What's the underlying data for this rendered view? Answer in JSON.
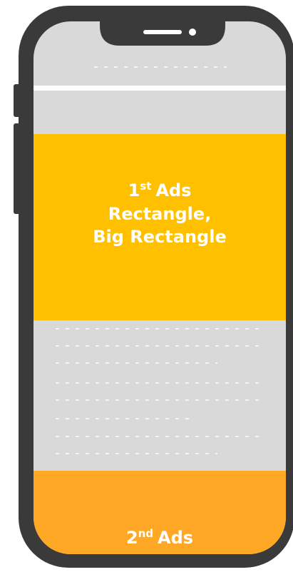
{
  "colors": {
    "phone_frame": "#3a3a3a",
    "screen_bg": "#d9d9d9",
    "header_bar_line": "#ffffff",
    "ad_first": "#ffc000",
    "ad_second": "#ffa826",
    "text_placeholder": "#ffffff"
  },
  "notch_icons": [
    "speaker-icon",
    "camera-icon"
  ],
  "ads": {
    "first": {
      "num": "1",
      "suffix": "st",
      "word": "Ads",
      "line2": "Rectangle,",
      "line3": "Big Rectangle"
    },
    "second": {
      "num": "2",
      "suffix": "nd",
      "word": "Ads"
    }
  }
}
